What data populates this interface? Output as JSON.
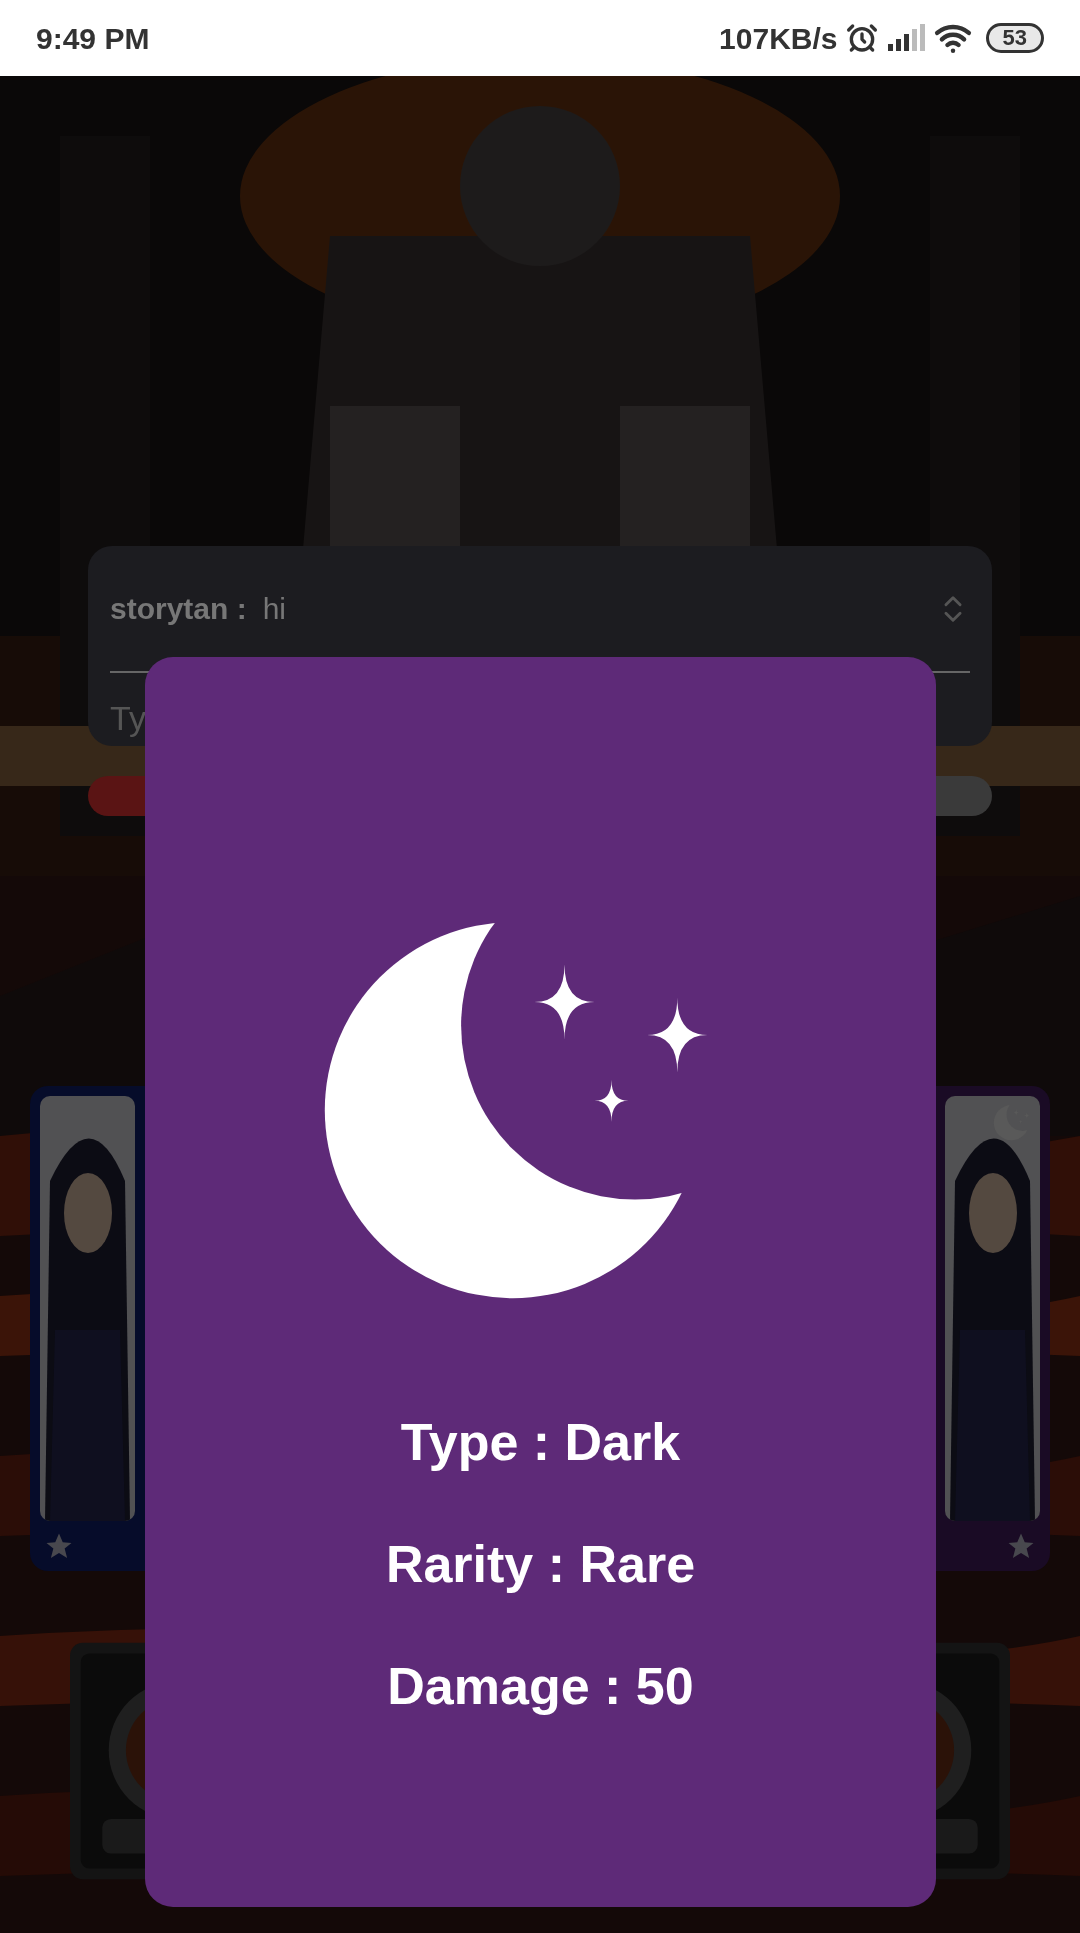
{
  "status_bar": {
    "time": "9:49 PM",
    "network_speed": "107KB/s",
    "battery": "53"
  },
  "chat": {
    "messages": [
      {
        "user": "storytan :",
        "text": "hi"
      }
    ],
    "input": {
      "placeholder": "Ty"
    }
  },
  "cards": [
    {
      "kind": "plain"
    },
    {
      "kind": "moon"
    }
  ],
  "dialog": {
    "lines": [
      "Type : Dark",
      "Rarity : Rare",
      "Damage : 50"
    ]
  }
}
